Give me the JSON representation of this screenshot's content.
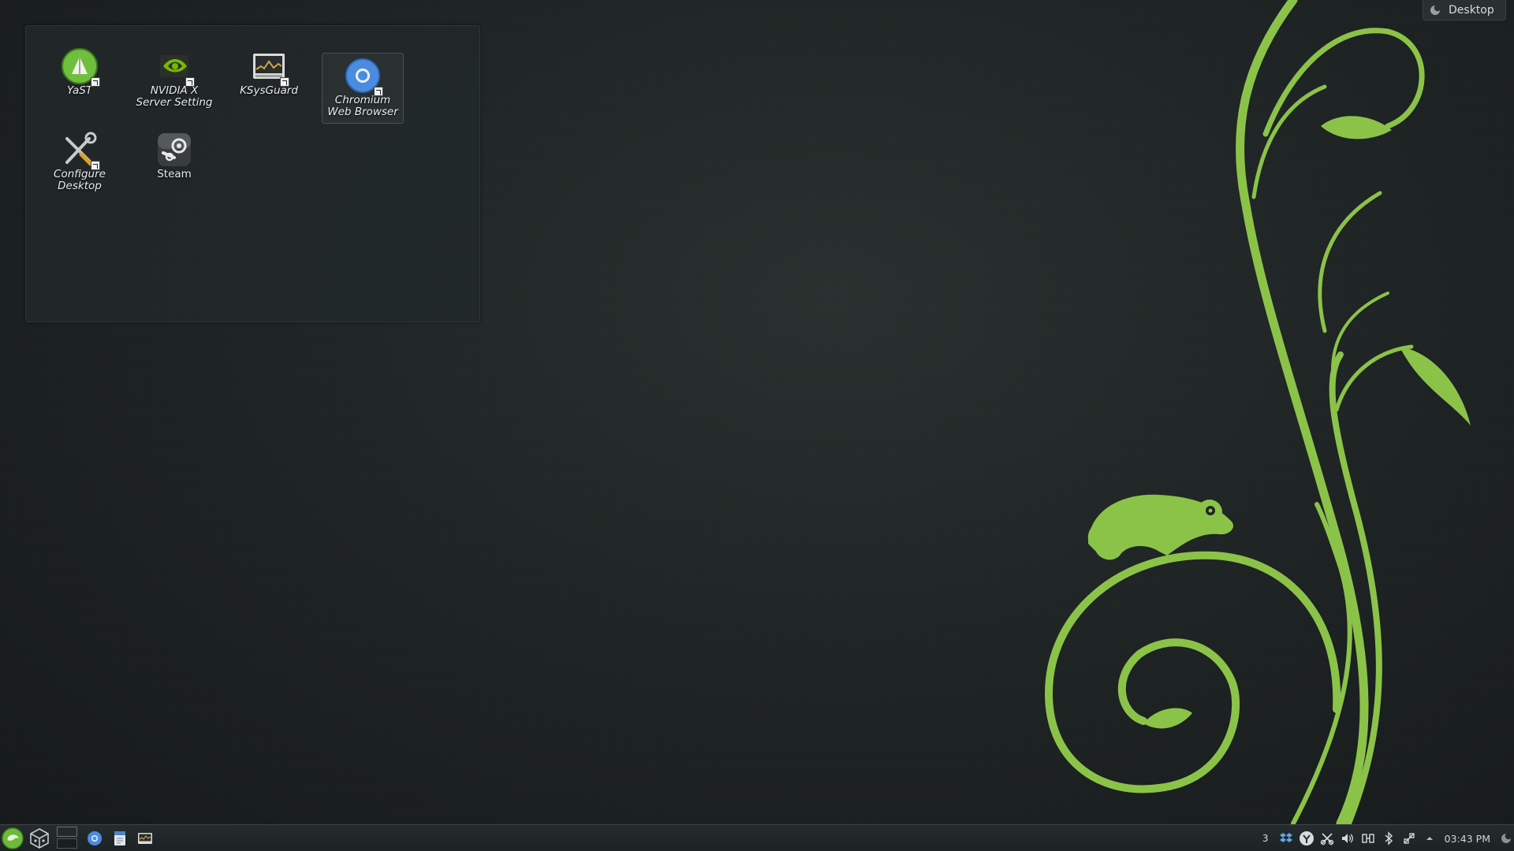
{
  "desktop": {
    "icons": [
      {
        "label": "YaST",
        "icon": "yast-icon"
      },
      {
        "label": "NVIDIA X\nServer Setting",
        "icon": "nvidia-icon"
      },
      {
        "label": "KSysGuard",
        "icon": "ksysguard-icon"
      },
      {
        "label": "Chromium\nWeb Browser",
        "icon": "chromium-icon"
      },
      {
        "label": "Configure\nDesktop",
        "icon": "configure-icon"
      },
      {
        "label": "Steam",
        "icon": "steam-icon"
      }
    ]
  },
  "toolbox": {
    "label": "Desktop"
  },
  "taskbar": {
    "launcher_icon": "opensuse-menu-icon",
    "activity_count": "3",
    "clock": "03:43 PM"
  },
  "colors": {
    "accent_green": "#8fc34a",
    "panel_bg": "#22282a"
  }
}
